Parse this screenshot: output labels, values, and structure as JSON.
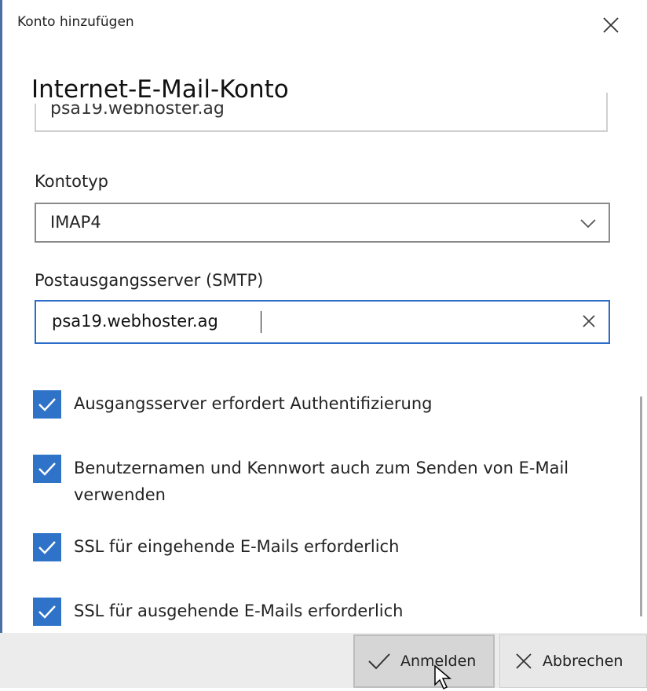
{
  "dialog": {
    "title": "Konto hinzufügen",
    "heading": "Internet-E-Mail-Konto"
  },
  "incoming_server": {
    "value": "psa19.webhoster.ag"
  },
  "account_type": {
    "label": "Kontotyp",
    "selected": "IMAP4"
  },
  "outgoing_server": {
    "label": "Postausgangsserver (SMTP)",
    "value": "psa19.webhoster.ag"
  },
  "options": [
    {
      "label": "Ausgangsserver erfordert Authentifizierung",
      "checked": true
    },
    {
      "label": "Benutzernamen und Kennwort auch zum Senden von E-Mail verwenden",
      "checked": true
    },
    {
      "label": "SSL für eingehende E-Mails erforderlich",
      "checked": true
    },
    {
      "label": "SSL für ausgehende E-Mails erforderlich",
      "checked": true
    }
  ],
  "buttons": {
    "sign_in": "Anmelden",
    "cancel": "Abbrechen"
  },
  "icons": {
    "close": "close-icon",
    "dropdown": "chevron-down-icon",
    "clear": "clear-icon",
    "check": "checkmark-icon",
    "cancel": "cross-icon"
  },
  "colors": {
    "accent": "#2f73c9",
    "focus_border": "#2a6cc8",
    "footer_bg": "#ececec"
  }
}
